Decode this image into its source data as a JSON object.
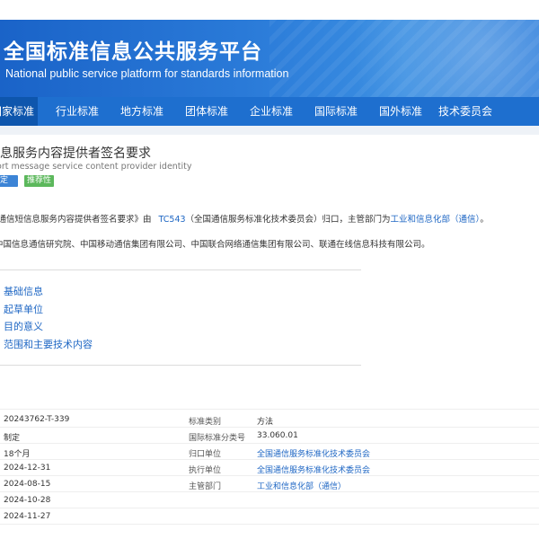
{
  "header": {
    "title_cn": "全国标准信息公共服务平台",
    "title_en": "National public service platform  for standards information"
  },
  "nav": {
    "items": [
      {
        "label": "国家标准",
        "active": true
      },
      {
        "label": "行业标准"
      },
      {
        "label": "地方标准"
      },
      {
        "label": "团体标准"
      },
      {
        "label": "企业标准"
      },
      {
        "label": "国际标准"
      },
      {
        "label": "国外标准"
      },
      {
        "label": "技术委员会"
      }
    ]
  },
  "standard": {
    "title_cn": "短信息服务内容提供者签名要求",
    "title_en": "Short message service content provider identity",
    "badge_status": "制定",
    "badge_type": "推荐性"
  },
  "description": {
    "prefix": "《通信短信息服务内容提供者签名要求》由",
    "tc_code": "TC543",
    "tc_name_part": "（全国通信服务标准化技术委员会）归口，主管部门为",
    "dept": "工业和信息化部（通信）",
    "suffix": "。",
    "drafters": "中国信息通信研究院、中国移动通信集团有限公司、中国联合网络通信集团有限公司、联通在线信息科技有限公司。"
  },
  "toc": [
    "基础信息",
    "起草单位",
    "目的意义",
    "范围和主要技术内容"
  ],
  "info": {
    "rows": [
      {
        "left_value": "20243762-T-339",
        "right_label": "标准类别",
        "right_value": "方法",
        "right_link": false
      },
      {
        "left_value": "制定",
        "right_label": "国际标准分类号",
        "right_value": "33.060.01",
        "right_link": false
      },
      {
        "left_value": "18个月",
        "right_label": "归口单位",
        "right_value": "全国通信服务标准化技术委员会",
        "right_link": true
      },
      {
        "left_value": "2024-12-31",
        "right_label": "执行单位",
        "right_value": "全国通信服务标准化技术委员会",
        "right_link": true
      },
      {
        "left_value": "2024-08-15",
        "right_label": "主管部门",
        "right_value": "工业和信息化部（通信）",
        "right_link": true
      },
      {
        "left_value": "2024-10-28",
        "right_label": "",
        "right_value": "",
        "right_link": false
      },
      {
        "left_value": "2024-11-27",
        "right_label": "",
        "right_value": "",
        "right_link": false
      }
    ]
  }
}
